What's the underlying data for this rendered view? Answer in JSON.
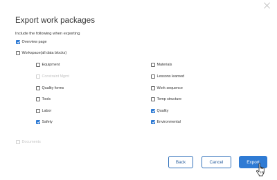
{
  "dialog": {
    "title": "Export work packages",
    "subtitle": "Include the following when exporting"
  },
  "options": {
    "overview": {
      "label": "Overview page",
      "checked": true
    },
    "workspace": {
      "label": "Workspace(all data blocks)",
      "checked": false
    },
    "documents": {
      "label": "Documents",
      "checked": false,
      "disabled": true
    }
  },
  "blocks": {
    "equipment": {
      "label": "Equipment",
      "checked": false
    },
    "constraint": {
      "label": "Constraint Mgmt",
      "checked": false,
      "disabled": true
    },
    "quality_forms": {
      "label": "Quality forms",
      "checked": false
    },
    "tools": {
      "label": "Tools",
      "checked": false
    },
    "labor": {
      "label": "Labor",
      "checked": false
    },
    "safety": {
      "label": "Safety",
      "checked": true
    },
    "materials": {
      "label": "Materials",
      "checked": false
    },
    "lessons": {
      "label": "Lessons learned",
      "checked": false
    },
    "work_sequence": {
      "label": "Work sequence",
      "checked": false
    },
    "temp_structure": {
      "label": "Temp structure",
      "checked": false
    },
    "quality": {
      "label": "Quality",
      "checked": true
    },
    "environmental": {
      "label": "Environmental",
      "checked": true
    }
  },
  "buttons": {
    "back": "Back",
    "cancel": "Cancel",
    "export": "Export"
  },
  "colors": {
    "accent": "#2f7bd4",
    "disabled_text": "#c4c4c4"
  },
  "icons": {
    "close": "close-icon",
    "cursor": "hand-pointer-icon"
  }
}
